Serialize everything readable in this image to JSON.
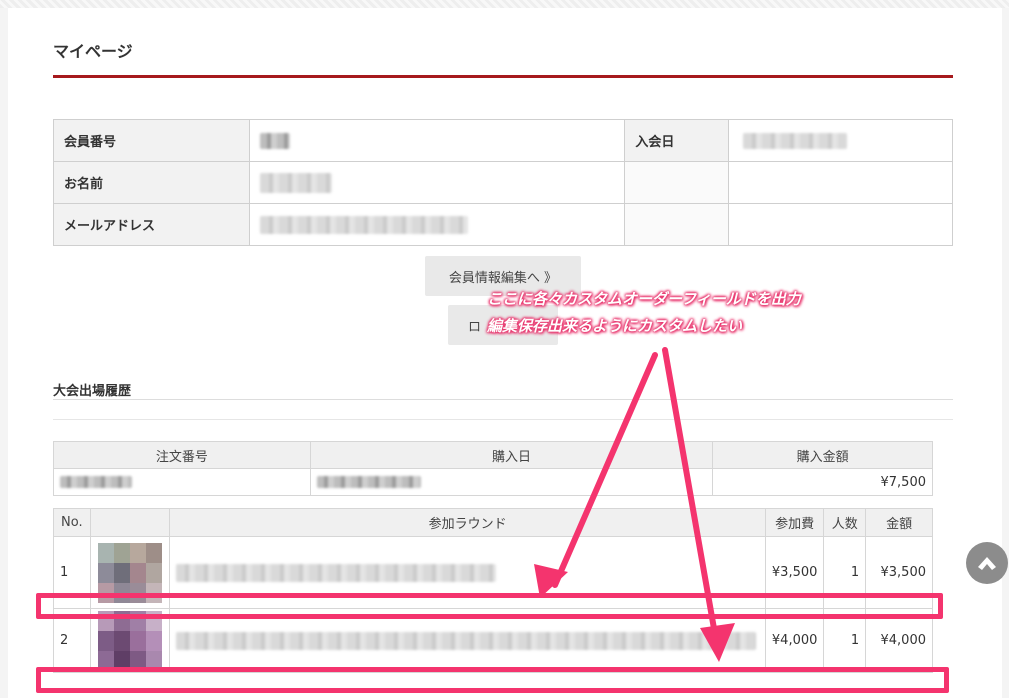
{
  "page_title": "マイページ",
  "member": {
    "member_no_label": "会員番号",
    "join_date_label": "入会日",
    "name_label": "お名前",
    "email_label": "メールアドレス"
  },
  "buttons": {
    "edit_label": "会員情報編集へ 》",
    "logout_label": "ロ"
  },
  "history": {
    "title": "大会出場履歴",
    "order_headers": [
      "注文番号",
      "購入日",
      "購入金額"
    ],
    "order_total": "¥7,500",
    "item_headers": [
      "No.",
      "",
      "参加ラウンド",
      "参加費",
      "人数",
      "金額"
    ],
    "items": [
      {
        "no": "1",
        "fee": "¥3,500",
        "qty": "1",
        "amount": "¥3,500"
      },
      {
        "no": "2",
        "fee": "¥4,000",
        "qty": "1",
        "amount": "¥4,000"
      }
    ]
  },
  "annotation": {
    "line1": "ここに各々カスタムオーダーフィールドを出力",
    "line2": "編集保存出来るようにカスタムしたい"
  },
  "colors": {
    "accent_rule": "#a6191d",
    "annotation_pink": "#f4346e"
  },
  "icons": {
    "scroll_top": "chevron-up-circle-icon"
  }
}
